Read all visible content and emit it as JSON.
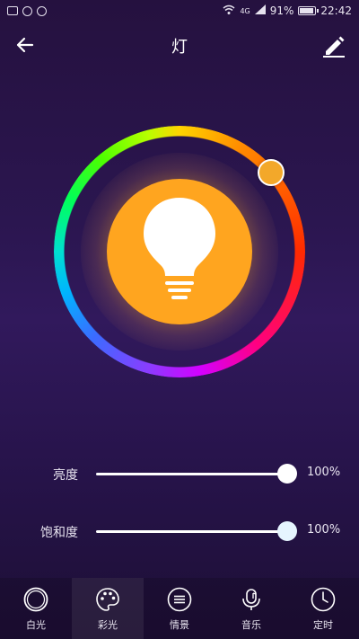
{
  "status_bar": {
    "network_label": "4G",
    "battery_percent": "91%",
    "battery_level": 0.91,
    "time": "22:42"
  },
  "header": {
    "title": "灯",
    "back_icon": "arrow-left-icon",
    "edit_icon": "pencil-icon"
  },
  "color_wheel": {
    "selected_color": "#f3a82a",
    "bulb_color": "#ffa51f",
    "bulb_icon": "lightbulb-icon"
  },
  "sliders": [
    {
      "label": "亮度",
      "value": 100,
      "value_label": "100%",
      "knob_color": "#ffffff"
    },
    {
      "label": "饱和度",
      "value": 100,
      "value_label": "100%",
      "knob_color": "#e6f5ff"
    }
  ],
  "bottom_nav": {
    "active": 1,
    "items": [
      {
        "label": "白光",
        "icon": "circle-icon"
      },
      {
        "label": "彩光",
        "icon": "palette-icon"
      },
      {
        "label": "情景",
        "icon": "scene-icon"
      },
      {
        "label": "音乐",
        "icon": "microphone-icon"
      },
      {
        "label": "定时",
        "icon": "clock-icon"
      }
    ]
  }
}
